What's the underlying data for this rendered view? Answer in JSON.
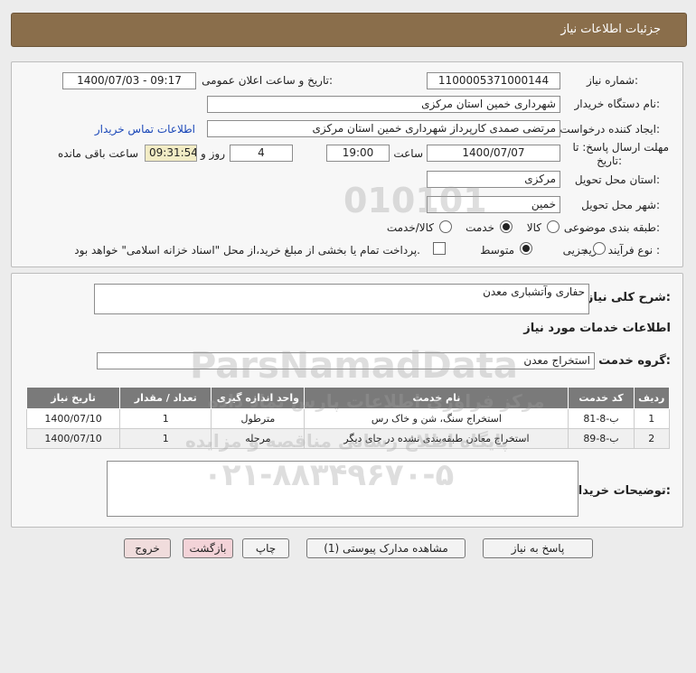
{
  "header": {
    "title": "جزئیات اطلاعات نیاز"
  },
  "form": {
    "need_number": {
      "label": "شماره نیاز:",
      "value": "1100005371000144"
    },
    "announce": {
      "label": "تاریخ و ساعت اعلان عمومی:",
      "value": "1400/07/03 - 09:17"
    },
    "buyer_org": {
      "label": "نام دستگاه خریدار:",
      "value": "شهرداری خمین استان مرکزی"
    },
    "requester": {
      "label": "ایجاد کننده درخواست:",
      "value": "مرتضی صمدی کارپرداز شهرداری خمین استان مرکزی"
    },
    "contact_link": "اطلاعات تماس خریدار",
    "deadline": {
      "label_line1": "مهلت ارسال پاسخ: تا",
      "label_line2": "تاریخ:",
      "date": "1400/07/07",
      "time_label": "ساعت",
      "time": "19:00",
      "days": "4",
      "days_label": "روز و",
      "remaining": "09:31:54",
      "remaining_label": "ساعت باقی مانده"
    },
    "province": {
      "label": "استان محل تحویل:",
      "value": "مرکزی"
    },
    "city": {
      "label": "شهر محل تحویل:",
      "value": "خمین"
    },
    "category": {
      "label": "طبقه بندی موضوعی:",
      "options": [
        "کالا",
        "خدمت",
        "کالا/خدمت"
      ],
      "selected": "خدمت"
    },
    "process": {
      "label": "نوع فرآیند خرید :",
      "options": [
        "جزیی",
        "متوسط"
      ],
      "selected": "متوسط",
      "note": "پرداخت تمام یا بخشی از مبلغ خرید،از محل \"اسناد خزانه اسلامی\" خواهد بود."
    }
  },
  "summary": {
    "label": "شرح کلی نیاز:",
    "value": "حفاری وآتشباری معدن",
    "services_title": "اطلاعات خدمات مورد نیاز",
    "group_label": "گروه خدمت:",
    "group_value": "استخراج معدن"
  },
  "table": {
    "headers": [
      "ردیف",
      "کد خدمت",
      "نام خدمت",
      "واحد اندازه گیری",
      "تعداد / مقدار",
      "تاریخ نیاز"
    ],
    "rows": [
      [
        "1",
        "ب-8-81",
        "استخراج سنگ، شن و خاک رس",
        "مترطول",
        "1",
        "1400/07/10"
      ],
      [
        "2",
        "ب-8-89",
        "استخراج معادن طبقه‌بندی نشده در جای دیگر",
        "مرحله",
        "1",
        "1400/07/10"
      ]
    ]
  },
  "buyer_notes": {
    "label": "توضیحات خریدار:",
    "value": ""
  },
  "buttons": {
    "reply": "پاسخ به نیاز",
    "attachments": "مشاهده مدارک پیوستی (1)",
    "print": "چاپ",
    "back": "بازگشت",
    "exit": "خروج"
  },
  "watermark": {
    "brand": "ParsNamadData",
    "numbers": "010101",
    "line1": "مرکز فراوری اطلاعات پارس نماد داده",
    "line2": "پایگاه اطلاع رسانی مناقصه و مزایده",
    "phone": "۰۲۱-۸۸۳۴۹۶۷۰-۵"
  }
}
